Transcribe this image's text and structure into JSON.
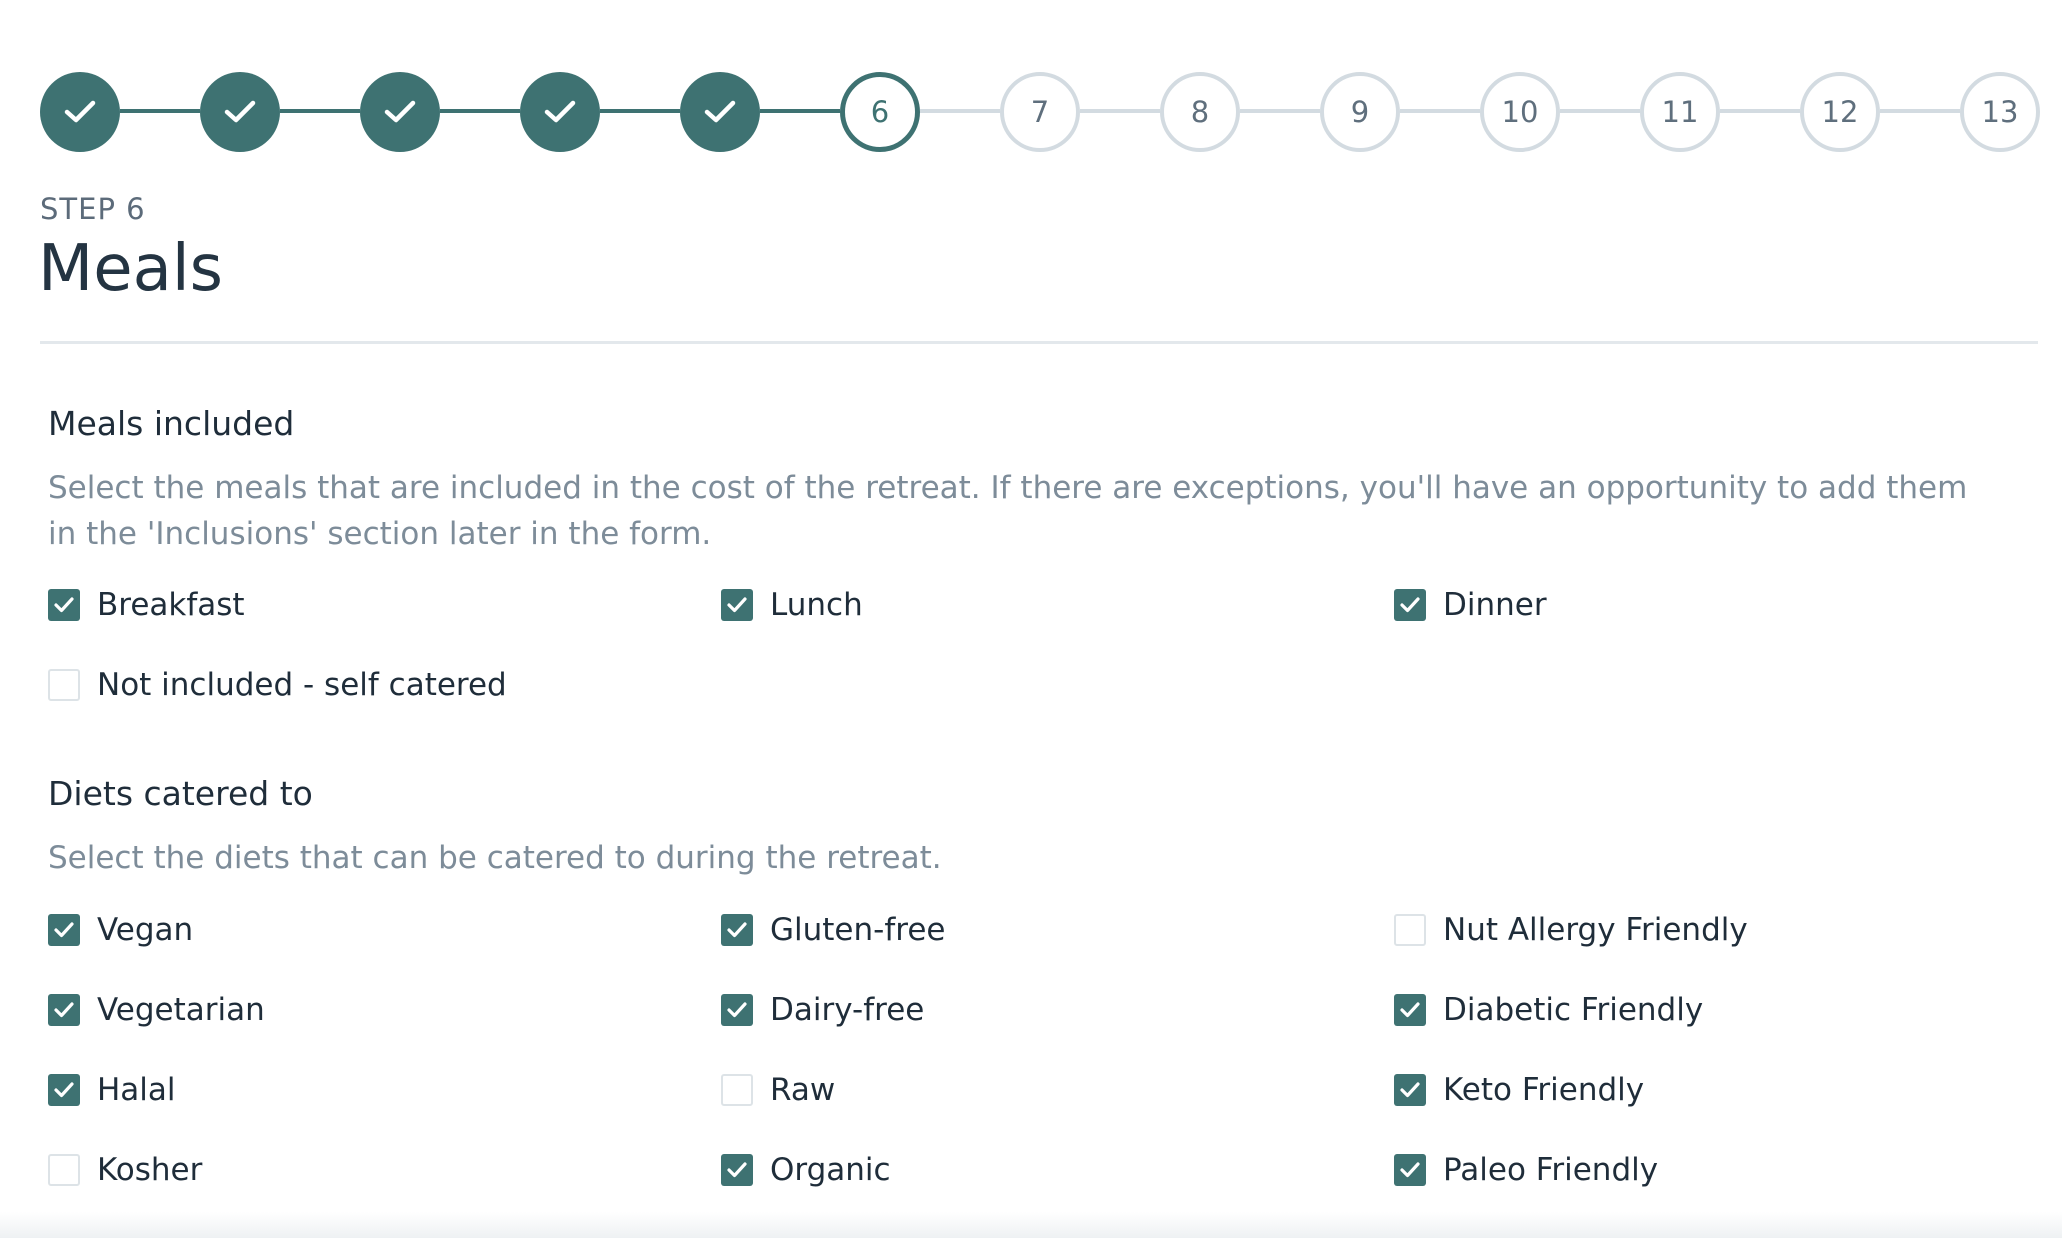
{
  "stepper": {
    "steps": [
      {
        "label": "",
        "state": "done",
        "icon": "check-icon"
      },
      {
        "label": "",
        "state": "done",
        "icon": "check-icon"
      },
      {
        "label": "",
        "state": "done",
        "icon": "check-icon"
      },
      {
        "label": "",
        "state": "done",
        "icon": "check-icon"
      },
      {
        "label": "",
        "state": "done",
        "icon": "check-icon"
      },
      {
        "label": "6",
        "state": "current"
      },
      {
        "label": "7",
        "state": "todo"
      },
      {
        "label": "8",
        "state": "todo"
      },
      {
        "label": "9",
        "state": "todo"
      },
      {
        "label": "10",
        "state": "todo"
      },
      {
        "label": "11",
        "state": "todo"
      },
      {
        "label": "12",
        "state": "todo"
      },
      {
        "label": "13",
        "state": "todo"
      }
    ]
  },
  "header": {
    "kicker": "STEP 6",
    "title": "Meals"
  },
  "meals": {
    "heading": "Meals included",
    "description": "Select the meals that are included in the cost of the retreat. If there are exceptions, you'll have an opportunity to add them in the 'Inclusions' section later in the form.",
    "options": [
      {
        "label": "Breakfast",
        "checked": true
      },
      {
        "label": "Lunch",
        "checked": true
      },
      {
        "label": "Dinner",
        "checked": true
      },
      {
        "label": "Not included - self catered",
        "checked": false
      }
    ]
  },
  "diets": {
    "heading": "Diets catered to",
    "description": "Select the diets that can be catered to during the retreat.",
    "options": [
      {
        "label": "Vegan",
        "checked": true
      },
      {
        "label": "Gluten-free",
        "checked": true
      },
      {
        "label": "Nut Allergy Friendly",
        "checked": false
      },
      {
        "label": "Vegetarian",
        "checked": true
      },
      {
        "label": "Dairy-free",
        "checked": true
      },
      {
        "label": "Diabetic Friendly",
        "checked": true
      },
      {
        "label": "Halal",
        "checked": true
      },
      {
        "label": "Raw",
        "checked": false
      },
      {
        "label": "Keto Friendly",
        "checked": true
      },
      {
        "label": "Kosher",
        "checked": false
      },
      {
        "label": "Organic",
        "checked": true
      },
      {
        "label": "Paleo Friendly",
        "checked": true
      }
    ]
  },
  "colors": {
    "accent": "#3e7272",
    "inactive": "#d3dbe1",
    "muted_text": "#7d8c99"
  }
}
